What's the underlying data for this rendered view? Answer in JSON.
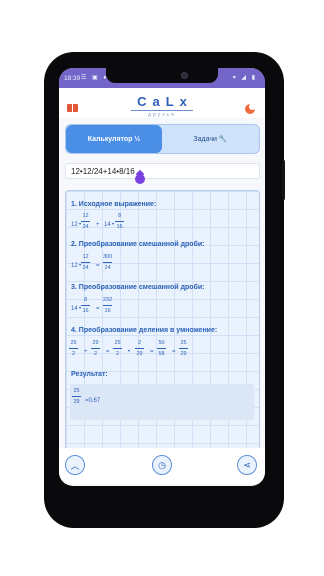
{
  "status": {
    "time": "18:39",
    "left_icons": "☰ ▣ ♦",
    "right_icons": "▾ ◢ ▮"
  },
  "app": {
    "title": "CaLx",
    "subtitle": "друзья"
  },
  "icons": {
    "menu": "book-icon",
    "theme": "theme-icon",
    "up": "up-icon",
    "history": "history-icon",
    "share": "share-icon"
  },
  "colors": {
    "accent": "#4a8ee6",
    "status_bar": "#7466c8",
    "cursor": "#7a3fe0",
    "orange": "#ef6a3a"
  },
  "tabs": {
    "calculator": "Калькулятор ½",
    "tasks": "Задачи 🔧"
  },
  "input": {
    "value": "12•12/24+14•8/16"
  },
  "steps": {
    "s1_title": "1. Исходное выражение:",
    "s2_title": "2. Преобразование смешанной дроби:",
    "s3_title": "3. Преобразование смешанной дроби:",
    "s4_title": "4. Преобразование деления в умножение:",
    "result_label": "Результат:",
    "n12": "12",
    "n24": "24",
    "n14": "14",
    "n8": "8",
    "n16": "16",
    "n300": "300",
    "n232": "232",
    "n25": "25",
    "n2": "2",
    "n29": "29",
    "n50": "50",
    "n58": "58",
    "plus": "+",
    "times": "•",
    "eq": "=",
    "approx": "=0,67"
  },
  "nav": {
    "back": "◀",
    "home": "●",
    "recent": "■"
  }
}
